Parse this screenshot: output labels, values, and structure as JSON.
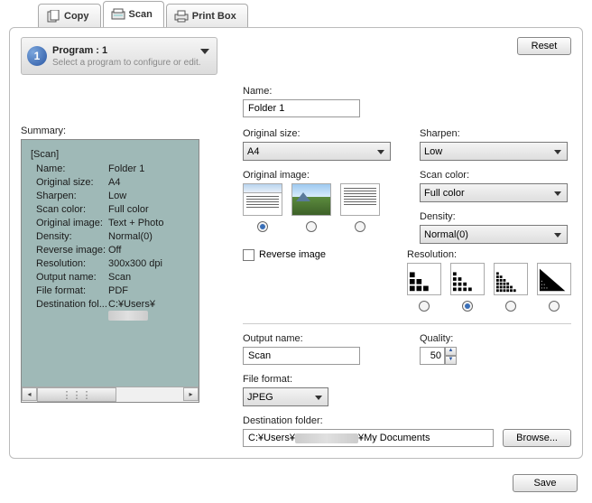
{
  "tabs": {
    "copy": "Copy",
    "scan": "Scan",
    "printbox": "Print Box"
  },
  "buttons": {
    "reset": "Reset",
    "browse": "Browse...",
    "save": "Save"
  },
  "program": {
    "num": "1",
    "title": "Program : 1",
    "sub": "Select a program to configure or edit."
  },
  "summary": {
    "label": "Summary:",
    "head": "[Scan]",
    "rows": [
      {
        "k": "Name:",
        "v": "Folder 1"
      },
      {
        "k": "Original size:",
        "v": "A4"
      },
      {
        "k": "Sharpen:",
        "v": "Low"
      },
      {
        "k": "Scan color:",
        "v": "Full color"
      },
      {
        "k": "Original image:",
        "v": "Text + Photo"
      },
      {
        "k": "Density:",
        "v": "Normal(0)"
      },
      {
        "k": "Reverse image:",
        "v": "Off"
      },
      {
        "k": "Resolution:",
        "v": "300x300 dpi"
      },
      {
        "k": "Output name:",
        "v": "Scan"
      },
      {
        "k": "File format:",
        "v": "PDF"
      },
      {
        "k": "Destination fol...",
        "v": "C:¥Users¥"
      }
    ]
  },
  "labels": {
    "name": "Name:",
    "orig_size": "Original size:",
    "sharpen": "Sharpen:",
    "orig_image": "Original image:",
    "scan_color": "Scan color:",
    "density": "Density:",
    "reverse": "Reverse image",
    "resolution": "Resolution:",
    "output": "Output name:",
    "quality": "Quality:",
    "file_fmt": "File format:",
    "dest": "Destination folder:"
  },
  "values": {
    "name": "Folder 1",
    "orig_size": "A4",
    "sharpen": "Low",
    "scan_color": "Full color",
    "density": "Normal(0)",
    "output": "Scan",
    "quality": "50",
    "file_fmt": "JPEG",
    "dest_pre": "C:¥Users¥",
    "dest_post": "¥My Documents"
  }
}
